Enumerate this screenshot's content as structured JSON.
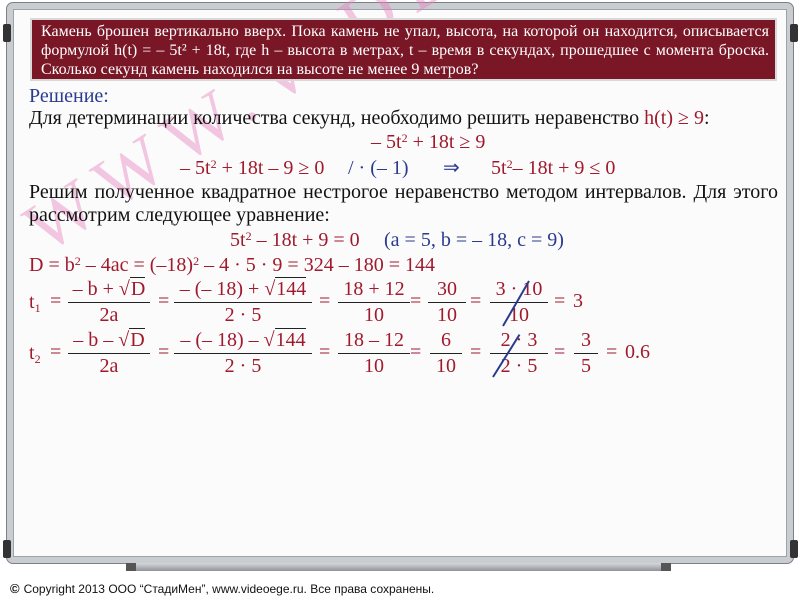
{
  "task": {
    "text": "Камень брошен вертикально вверх. Пока камень не упал, высота, на которой он находится, описывается формулой h(t) = – 5t² + 18t, где h – высота в метрах, t – время в секундах, прошедшее с момента броска. Сколько секунд камень находился на высоте не менее 9 метров?"
  },
  "solution": {
    "label": "Решение:",
    "line1_a": "Для детерминации количества секунд, необходимо решить неравенство ",
    "line1_b": "h(t) ≥ 9",
    "line1_c": ":",
    "ineq1_a": "– 5t",
    "ineq1_b": " + 18t ≥ 9",
    "ineq2_a": "– 5t",
    "ineq2_b": " + 18t – 9 ≥ 0",
    "ineq2_op": "/ · (– 1)",
    "ineq2_arrow": "⇒",
    "ineq2_c": "5t",
    "ineq2_d": "– 18t + 9 ≤ 0",
    "para": "Решим полученное квадратное нестрогое неравенство методом интервалов. Для этого рассмотрим следующее уравнение:",
    "eq_a": "5t",
    "eq_b": " – 18t + 9 = 0",
    "eq_coef": "(a = 5, b = – 18, c = 9)",
    "disc_a": "D = b",
    "disc_b": " – 4ac = (–18)",
    "disc_c": " – 4 · 5 · 9 = 324 – 180 = 144",
    "sup2": "2",
    "t1": {
      "label": "t",
      "sub": "1",
      "f1_num_a": "– b + ",
      "f1_num_b": "D",
      "f1_den": "2a",
      "f2_num_a": "– (– 18) + ",
      "f2_num_b": "144",
      "f2_den": "2 · 5",
      "f3_num": "18 + 12",
      "f3_den": "10",
      "f4_num": "30",
      "f4_den": "10",
      "f5_num": "3 · 10",
      "f5_den": "10",
      "result": "3"
    },
    "t2": {
      "label": "t",
      "sub": "2",
      "f1_num_a": "– b – ",
      "f1_num_b": "D",
      "f1_den": "2a",
      "f2_num_a": "– (– 18) – ",
      "f2_num_b": "144",
      "f2_den": "2 · 5",
      "f3_num": "18 – 12",
      "f3_den": "10",
      "f4_num": "6",
      "f4_den": "10",
      "f5_num": "2 · 3",
      "f5_den": "2 · 5",
      "f6_num": "3",
      "f6_den": "5",
      "result": "0.6"
    },
    "eq_sign": "=",
    "sqrt_sign": "√"
  },
  "watermark": "WWW.VIDEOEGE.RU",
  "footer": {
    "icon": "©",
    "text": "Copyright 2013   ООО “СтадиМен”, www.videoege.ru.   Все права сохранены."
  },
  "colors": {
    "banner": "#7a1726",
    "formula_red": "#a0192d",
    "label_blue": "#2a3b8f",
    "watermark_pink": "#e682be"
  }
}
